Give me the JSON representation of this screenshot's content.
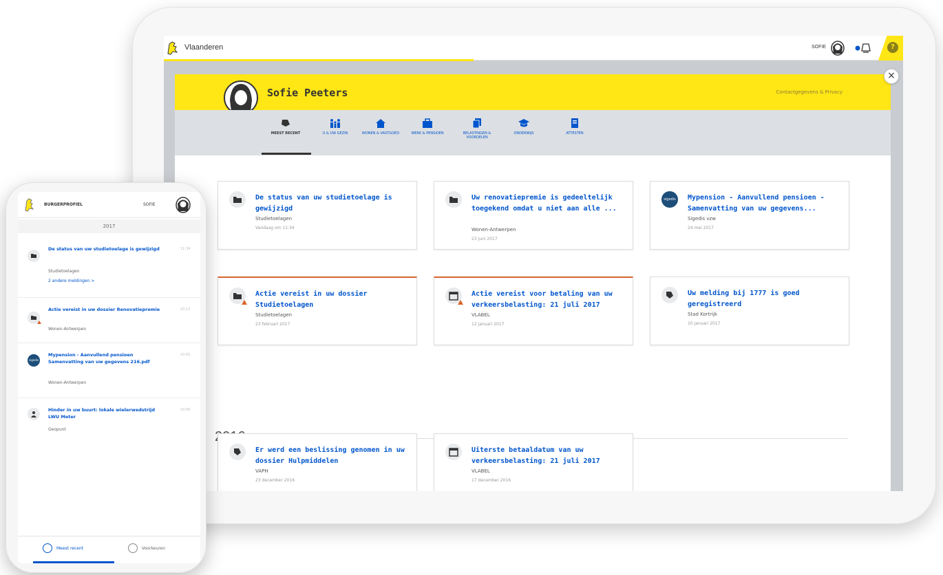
{
  "tablet": {
    "brand": "Vlaanderen",
    "user": "SOFIE",
    "profile_name": "Sofie Peeters",
    "privacy_link": "Contactgegevens & Privacy",
    "tabs": [
      {
        "label": "MEEST RECENT",
        "icon": "bell-icon"
      },
      {
        "label": "U & UW GEZIN",
        "icon": "family-icon"
      },
      {
        "label": "WONEN & VASTGOED",
        "icon": "house-icon"
      },
      {
        "label": "WERK & PENSIOEN",
        "icon": "briefcase-icon"
      },
      {
        "label": "BELASTINGEN & VOORDELEN",
        "icon": "documents-icon"
      },
      {
        "label": "ONDERWIJS",
        "icon": "graduation-cap-icon"
      },
      {
        "label": "ATTESTEN",
        "icon": "certificate-icon"
      }
    ],
    "cards_2017": [
      {
        "title": "De status van uw studietoelage is gewijzigd",
        "source": "Studietoelagen",
        "date": "Vandaag om 11:34",
        "icon": "folder-icon",
        "alert": false
      },
      {
        "title": "Uw renovatiepremie is gedeeltelijk toegekend omdat u niet aan alle ...",
        "source": "Wonen-Antwerpen",
        "date": "23 juni 2017",
        "icon": "folder-icon",
        "alert": false
      },
      {
        "title": "Mypension - Aanvullend pensioen - Samenvatting van uw gegevens...",
        "source": "Sigedis vzw",
        "date": "24 mei 2017",
        "icon": "sigedis-logo",
        "alert": false
      },
      {
        "title": "Actie vereist in uw dossier Studietoelagen",
        "source": "Studietoelagen",
        "date": "23 februari 2017",
        "icon": "folder-icon",
        "alert": true
      },
      {
        "title": "Actie vereist voor betaling van uw verkeersbelasting: 21 juli 2017",
        "source": "VLABEL",
        "date": "12 januari 2017",
        "icon": "calendar-icon",
        "alert": true
      },
      {
        "title": "Uw melding bij 1777 is goed geregistreerd",
        "source": "Stad Kortrijk",
        "date": "10 januari 2017",
        "icon": "lion-icon",
        "alert": false
      }
    ],
    "year_2016": "2016",
    "cards_2016": [
      {
        "title": "Er werd een beslissing genomen in uw dossier Hulpmiddelen",
        "source": "VAPH",
        "date": "23 december 2016",
        "icon": "lion-icon"
      },
      {
        "title": "Uiterste betaaldatum van uw verkeersbelasting: 21 juli 2017",
        "source": "VLABEL",
        "date": "17 december 2016",
        "icon": "calendar-icon"
      }
    ]
  },
  "phone": {
    "title": "BURGERPROFIEL",
    "user": "SOFIE",
    "year": "2017",
    "items": [
      {
        "title": "De status van uw studietoelage is gewijzigd",
        "source": "Studietoelagen",
        "more": "2 andere meldingen >",
        "time": "11:34"
      },
      {
        "title": "Actie vereist in uw dossier Renovatiepremie",
        "source": "Wonen-Antwerpen",
        "time": "10:12"
      },
      {
        "title": "Mypension - Aanvullend pensioen Samenvatting van uw gegevens 216.pdf",
        "source": "Wonen-Antwerpen",
        "time": "10:01"
      },
      {
        "title": "Hinder in uw buurt: lokale wielerwedstrijd LWU Meter",
        "source": "Geopunt",
        "time": "10:00"
      }
    ],
    "bottom_tabs": [
      {
        "label": "Meest recent"
      },
      {
        "label": "Voorkeuren"
      }
    ]
  },
  "colors": {
    "accent_yellow": "#ffe615",
    "link_blue": "#0055cc",
    "alert_orange": "#d9642b"
  }
}
